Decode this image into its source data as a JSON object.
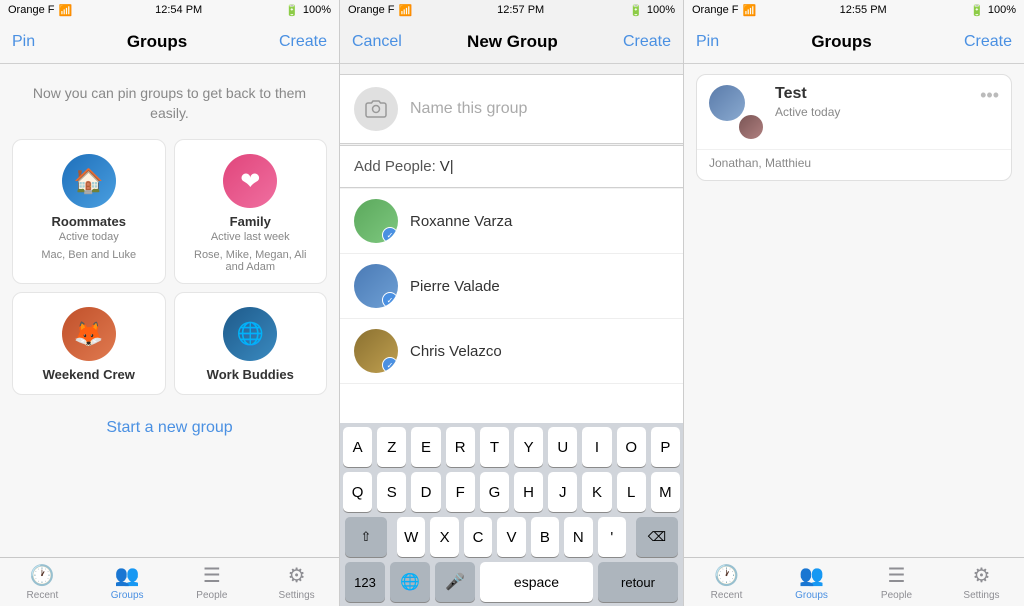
{
  "panels": {
    "left": {
      "status": {
        "carrier": "Orange F",
        "time": "12:54 PM",
        "battery": "100%"
      },
      "nav": {
        "left_label": "Pin",
        "title": "Groups",
        "right_label": "Create"
      },
      "info_text": "Now you can pin groups to get back to them easily.",
      "groups": [
        {
          "name": "Roommates",
          "status": "Active today",
          "members": "Mac, Ben and Luke",
          "avatar_type": "roommates"
        },
        {
          "name": "Family",
          "status": "Active last week",
          "members": "Rose, Mike, Megan, Ali and Adam",
          "avatar_type": "family"
        },
        {
          "name": "Weekend Crew",
          "status": "",
          "members": "",
          "avatar_type": "weekend"
        },
        {
          "name": "Work Buddies",
          "status": "",
          "members": "",
          "avatar_type": "workbuddies"
        }
      ],
      "start_new_label": "Start a new group",
      "tabs": [
        {
          "label": "Recent",
          "icon": "clock",
          "active": false
        },
        {
          "label": "Groups",
          "icon": "groups",
          "active": true
        },
        {
          "label": "People",
          "icon": "people",
          "active": false
        },
        {
          "label": "Settings",
          "icon": "gear",
          "active": false
        }
      ]
    },
    "middle": {
      "status": {
        "carrier": "Orange F",
        "time": "12:57 PM",
        "battery": "100%"
      },
      "nav": {
        "left_label": "Cancel",
        "title": "New Group",
        "right_label": "Create"
      },
      "name_placeholder": "Name this group",
      "add_people_label": "Add People:",
      "add_people_value": "V|",
      "contacts": [
        {
          "name": "Roxanne Varza",
          "avatar_type": "roxanne"
        },
        {
          "name": "Pierre Valade",
          "avatar_type": "pierre"
        },
        {
          "name": "Chris Velazco",
          "avatar_type": "chris"
        }
      ],
      "keyboard": {
        "rows": [
          [
            "A",
            "Z",
            "E",
            "R",
            "T",
            "Y",
            "U",
            "I",
            "O",
            "P"
          ],
          [
            "Q",
            "S",
            "D",
            "F",
            "G",
            "H",
            "J",
            "K",
            "L",
            "M"
          ],
          [
            "W",
            "X",
            "C",
            "V",
            "B",
            "N"
          ]
        ],
        "bottom": {
          "num_label": "123",
          "space_label": "espace",
          "return_label": "retour"
        }
      },
      "tabs": [
        {
          "label": "Recent",
          "icon": "clock",
          "active": false
        },
        {
          "label": "Groups",
          "icon": "groups",
          "active": true
        },
        {
          "label": "People",
          "icon": "people",
          "active": false
        },
        {
          "label": "Settings",
          "icon": "gear",
          "active": false
        }
      ]
    },
    "right": {
      "status": {
        "carrier": "Orange F",
        "time": "12:55 PM",
        "battery": "100%"
      },
      "nav": {
        "left_label": "Pin",
        "title": "Groups",
        "right_label": "Create"
      },
      "group": {
        "name": "Test",
        "status": "Active today",
        "members": "Jonathan, Matthieu"
      },
      "tabs": [
        {
          "label": "Recent",
          "icon": "clock",
          "active": false
        },
        {
          "label": "Groups",
          "icon": "groups",
          "active": true
        },
        {
          "label": "People",
          "icon": "people",
          "active": false
        },
        {
          "label": "Settings",
          "icon": "gear",
          "active": false
        }
      ]
    }
  }
}
